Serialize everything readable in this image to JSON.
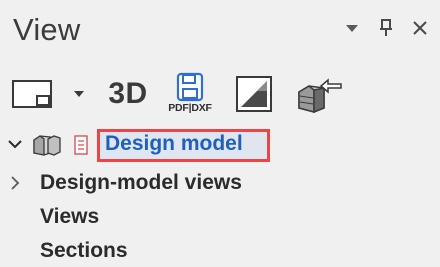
{
  "panel": {
    "title": "View",
    "controls": {
      "dropdown_icon": "triangle-down-icon",
      "pin_icon": "pin-icon",
      "close_icon": "close-icon"
    }
  },
  "toolbar": {
    "layout_icon": "window-layout-icon",
    "btn_3d_label": "3D",
    "pdfdxf_label": "PDF|DXF",
    "view_icon": "section-view-icon",
    "export_icon": "model-export-icon"
  },
  "tree": {
    "root": {
      "label": "Design model",
      "icons": [
        "cube-group-icon",
        "document-icon"
      ]
    },
    "children": [
      {
        "label": "Design-model views"
      },
      {
        "label": "Views"
      },
      {
        "label": "Sections"
      }
    ]
  },
  "colors": {
    "selection_text": "#1f5fbf",
    "highlight_border": "#e8474a",
    "save_icon_blue": "#2f6fd0"
  }
}
